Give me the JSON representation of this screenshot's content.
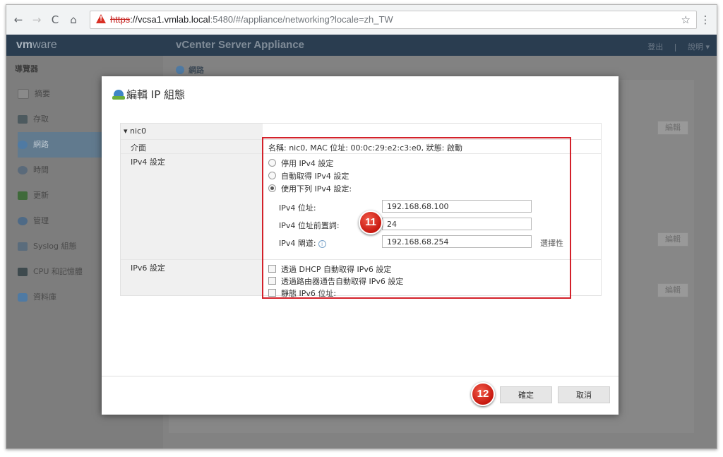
{
  "browser": {
    "url_scheme": "https",
    "url_host": "://vcsa1.vmlab.local",
    "url_path": ":5480/#/appliance/networking?locale=zh_TW"
  },
  "header": {
    "logo_vm": "vm",
    "logo_ware": "ware",
    "app_title": "vCenter Server Appliance",
    "logout": "登出",
    "separator": "|",
    "help": "說明 ▾"
  },
  "sidebar": {
    "title": "導覽器",
    "items": [
      {
        "label": "摘要"
      },
      {
        "label": "存取"
      },
      {
        "label": "網路"
      },
      {
        "label": "時間"
      },
      {
        "label": "更新"
      },
      {
        "label": "管理"
      },
      {
        "label": "Syslog 組態"
      },
      {
        "label": "CPU 和記憶體"
      },
      {
        "label": "資料庫"
      }
    ]
  },
  "content": {
    "breadcrumb": "網路",
    "edit_label": "編輯"
  },
  "dialog": {
    "title": "編輯 IP 組態",
    "nic": "nic0",
    "interface_label": "介面",
    "interface_value": "名稱: nic0, MAC 位址: 00:0c:29:e2:c3:e0, 狀態: 啟動",
    "ipv4_label": "IPv4 設定",
    "ipv4_options": [
      {
        "label": "停用 IPv4 設定",
        "selected": false
      },
      {
        "label": "自動取得 IPv4 設定",
        "selected": false
      },
      {
        "label": "使用下列 IPv4 設定:",
        "selected": true
      }
    ],
    "ipv4_address_label": "IPv4 位址:",
    "ipv4_address_value": "192.168.68.100",
    "ipv4_prefix_label": "IPv4 位址前置詞:",
    "ipv4_prefix_value": "24",
    "ipv4_gateway_label": "IPv4 閘道:",
    "ipv4_gateway_value": "192.168.68.254",
    "optional": "選擇性",
    "ipv6_label": "IPv6 設定",
    "ipv6_options": [
      {
        "label": "透過 DHCP 自動取得 IPv6 設定",
        "checked": false
      },
      {
        "label": "透過路由器通告自動取得 IPv6 設定",
        "checked": false
      },
      {
        "label": "靜態 IPv6 位址:",
        "checked": false
      }
    ],
    "ok": "確定",
    "cancel": "取消"
  },
  "annotations": {
    "step_a": "11",
    "step_b": "12"
  }
}
